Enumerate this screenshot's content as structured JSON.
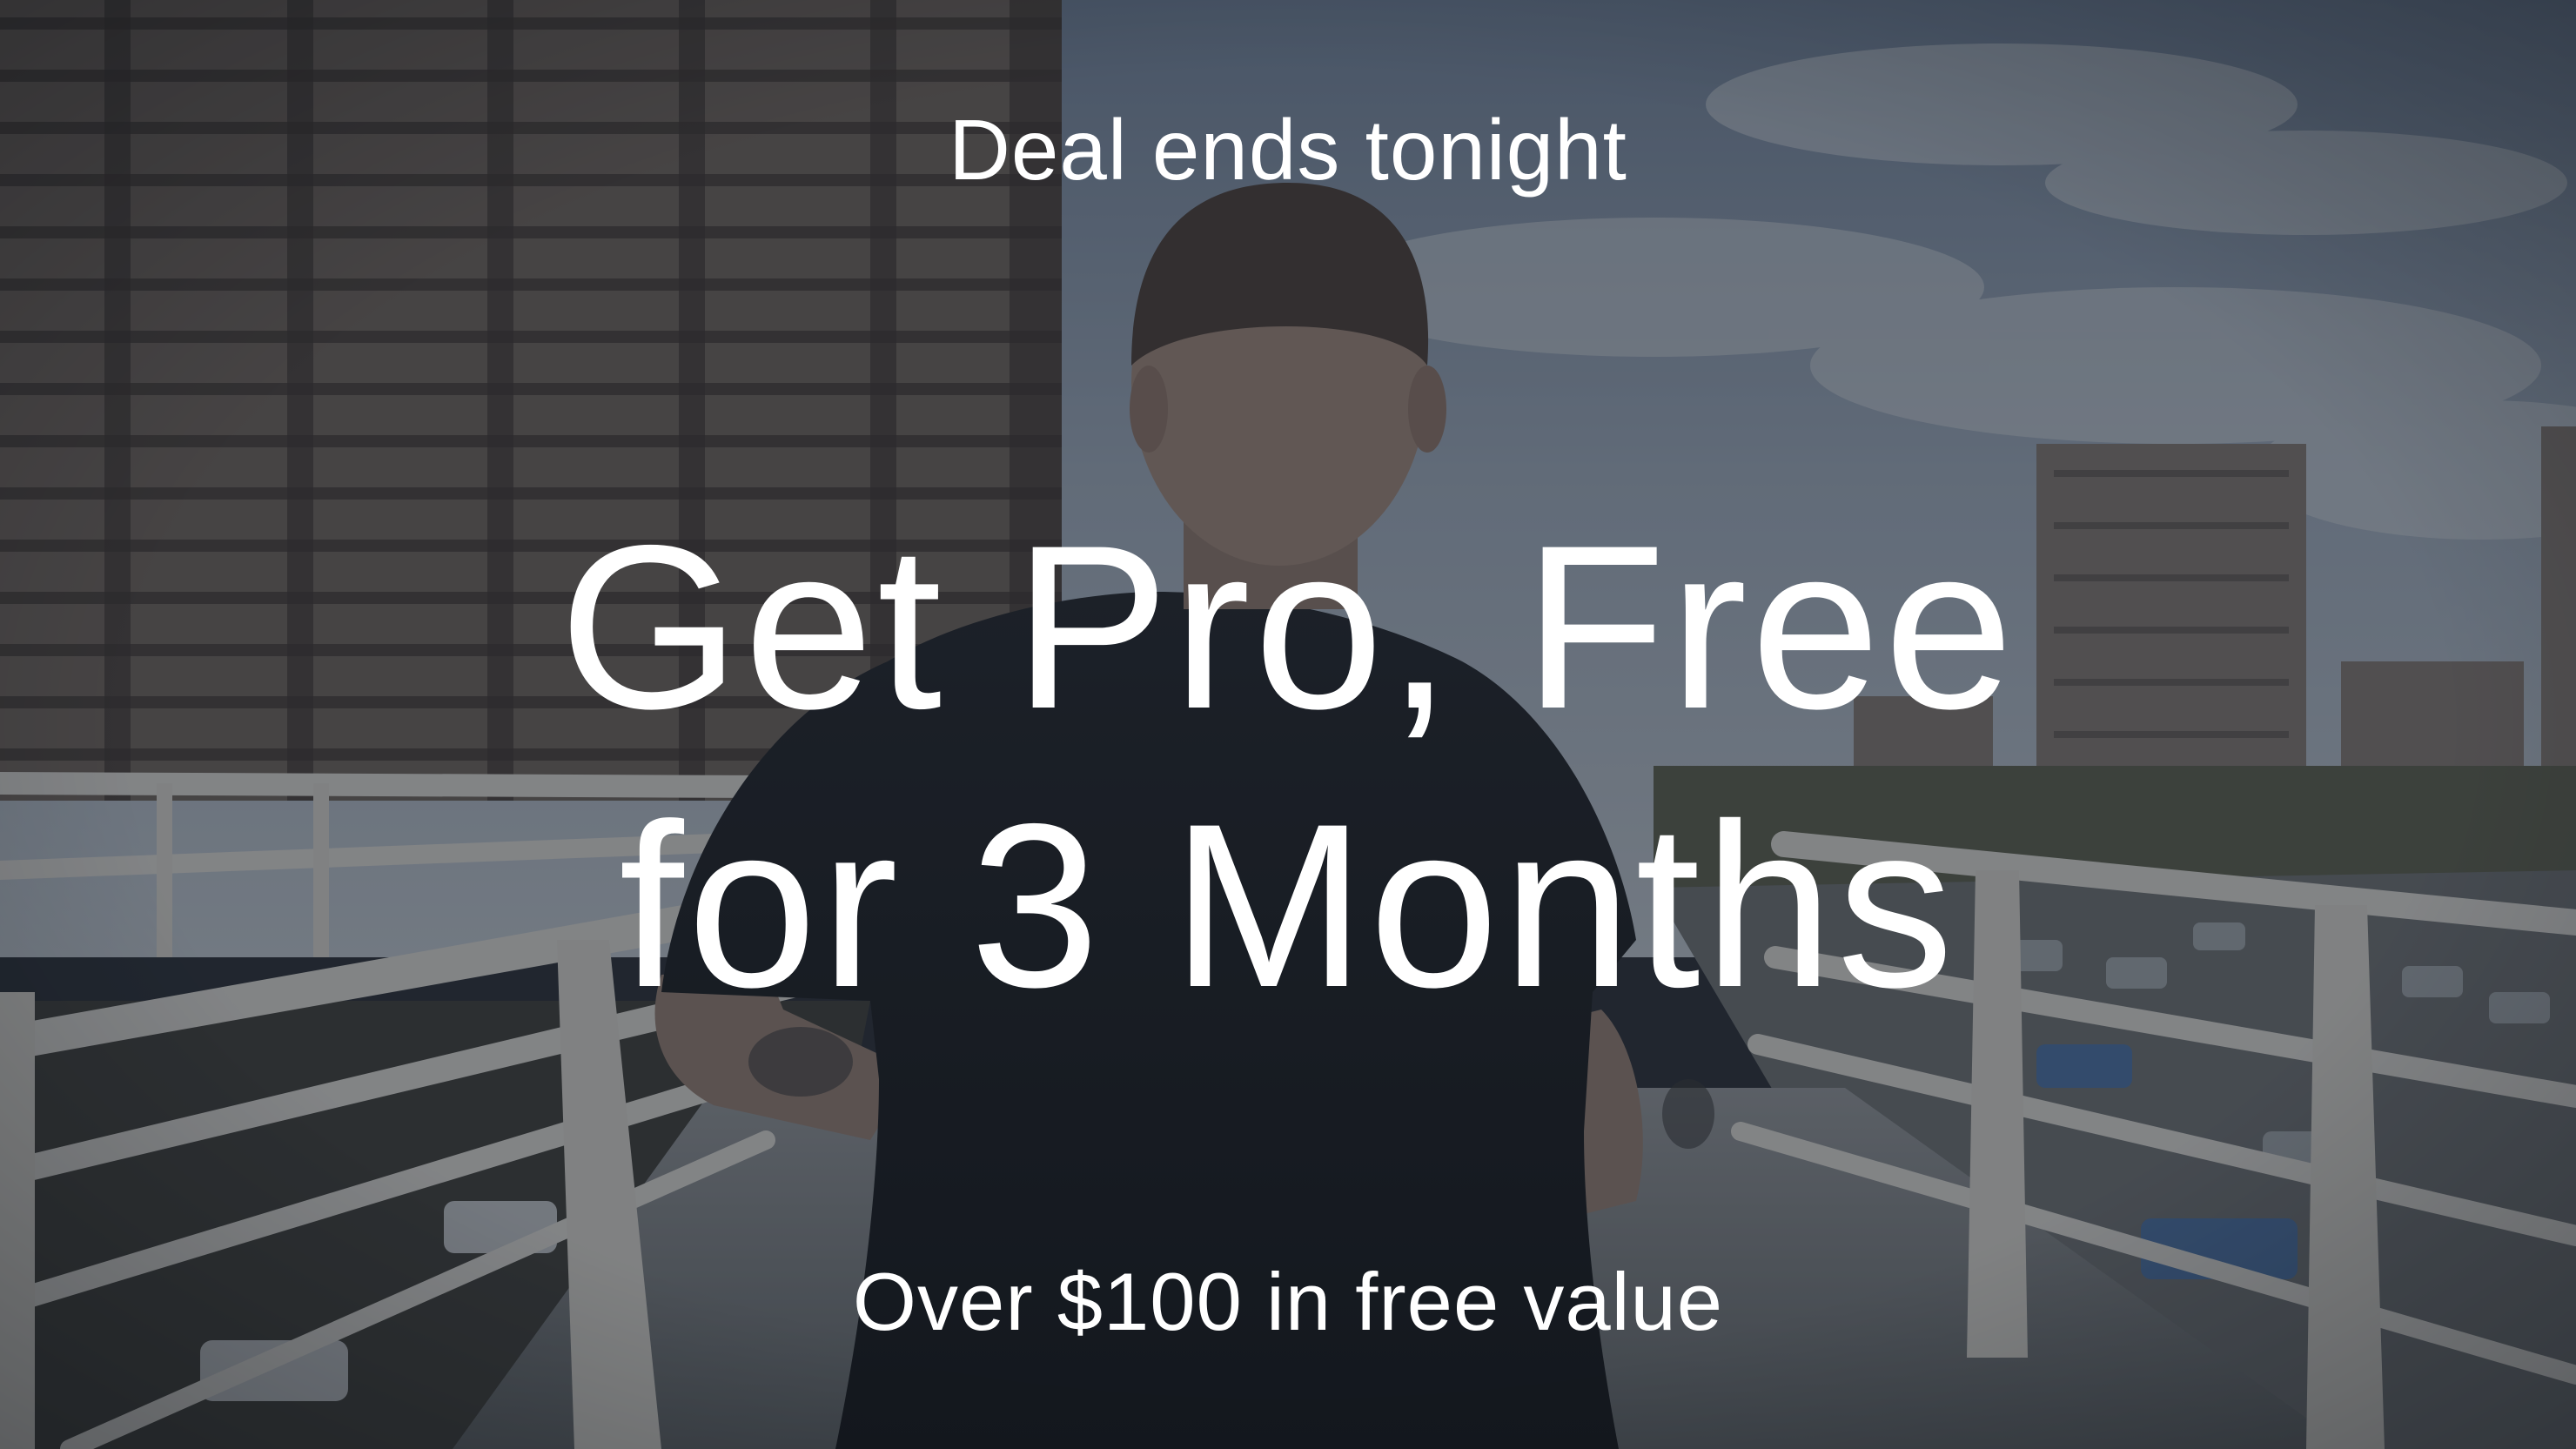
{
  "promo": {
    "eyebrow": "Deal ends tonight",
    "headline_line1": "Get Pro, Free",
    "headline_line2": "for 3 Months",
    "subtext": "Over $100 in free value"
  },
  "background": {
    "scene": "runner-on-bridge-photo",
    "overlay_color": "#141a24"
  }
}
